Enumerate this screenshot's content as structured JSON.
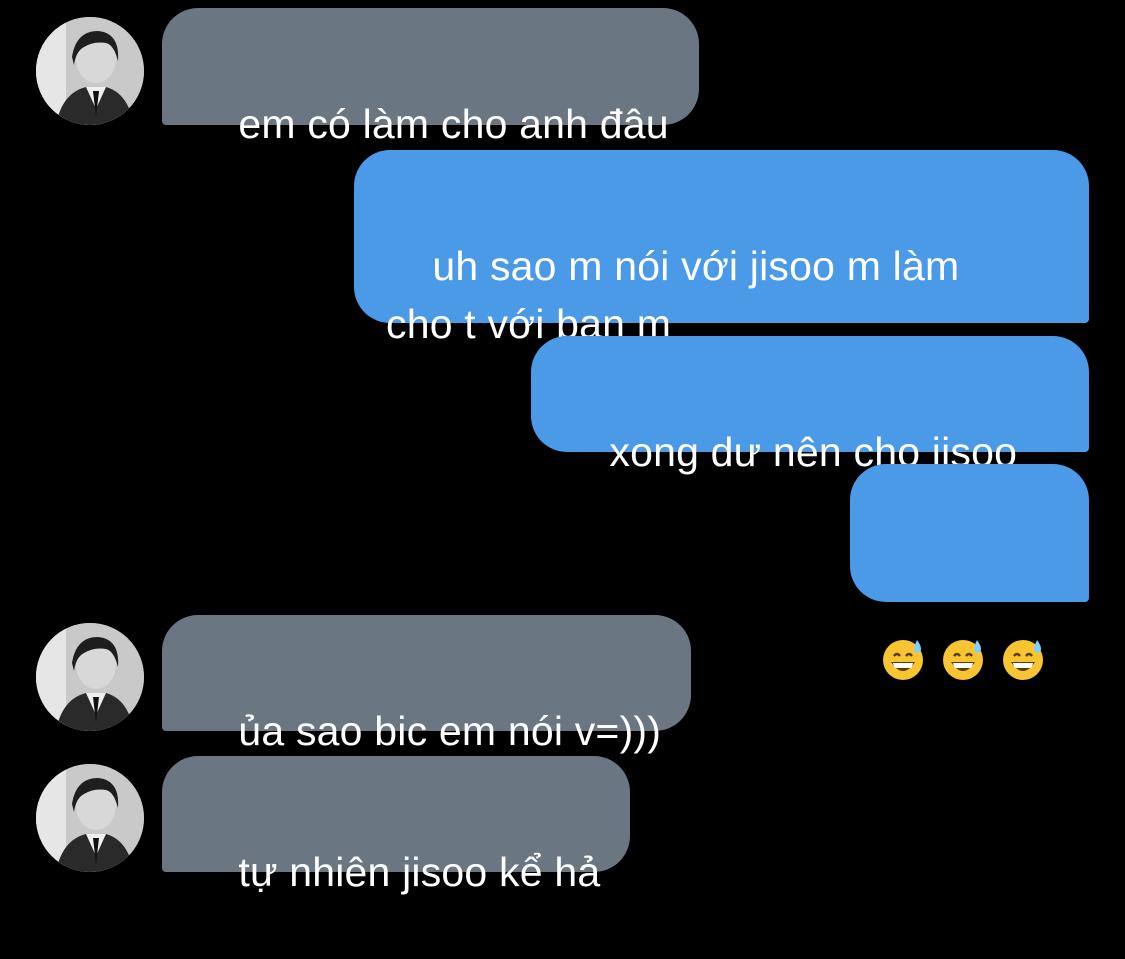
{
  "conversation": {
    "messages": [
      {
        "sender": "other",
        "text": "em có làm cho anh đâu"
      },
      {
        "sender": "me",
        "text": "uh sao m nói với jisoo m làm\ncho t với bạn m"
      },
      {
        "sender": "me",
        "text": "xong dư nên cho jisoo"
      },
      {
        "sender": "me",
        "emoji": [
          "grinning-face-with-sweat",
          "grinning-face-with-sweat",
          "grinning-face-with-sweat"
        ]
      },
      {
        "sender": "other",
        "text": "ủa sao bic em nói v=)))"
      },
      {
        "sender": "other",
        "text": "tự nhiên jisoo kể hả"
      }
    ]
  },
  "colors": {
    "background": "#000000",
    "incoming_bubble": "#6b7683",
    "outgoing_bubble": "#4a9ae7",
    "text": "#ffffff"
  }
}
